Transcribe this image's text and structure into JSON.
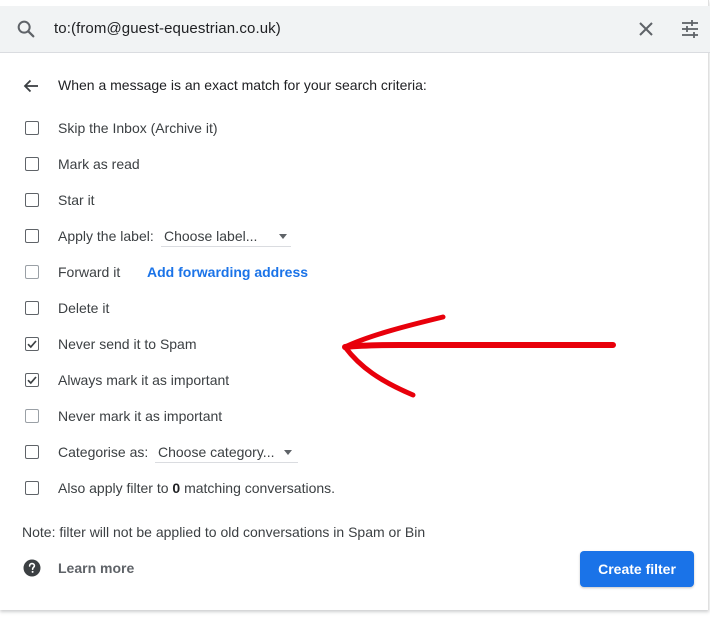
{
  "search": {
    "query": "to:(from@guest-equestrian.co.uk)",
    "icon": "search-icon",
    "close_icon": "close-icon",
    "options_icon": "tune-icon"
  },
  "header": {
    "back_icon": "arrow-back-icon",
    "text": "When a message is an exact match for your search criteria:"
  },
  "options": [
    {
      "label": "Skip the Inbox (Archive it)",
      "checked": false
    },
    {
      "label": "Mark as read",
      "checked": false
    },
    {
      "label": "Star it",
      "checked": false
    },
    {
      "label": "Apply the label:",
      "checked": false,
      "dropdown": "Choose label..."
    },
    {
      "label": "Forward it",
      "checked": false,
      "disabled": true,
      "link": "Add forwarding address"
    },
    {
      "label": "Delete it",
      "checked": false
    },
    {
      "label": "Never send it to Spam",
      "checked": true
    },
    {
      "label": "Always mark it as important",
      "checked": true
    },
    {
      "label": "Never mark it as important",
      "checked": false,
      "disabled": true
    },
    {
      "label": "Categorise as:",
      "checked": false,
      "dropdown": "Choose category..."
    },
    {
      "label_prefix": "Also apply filter to ",
      "count": "0",
      "label_suffix": " matching conversations.",
      "checked": false
    }
  ],
  "note": "Note: filter will not be applied to old conversations in Spam or Bin",
  "footer": {
    "help_icon": "help-icon",
    "learn_more": "Learn more",
    "create_filter": "Create filter"
  },
  "colors": {
    "accent": "#1a73e8",
    "annotation_arrow": "#e8000b",
    "search_bg": "#f1f3f4"
  }
}
